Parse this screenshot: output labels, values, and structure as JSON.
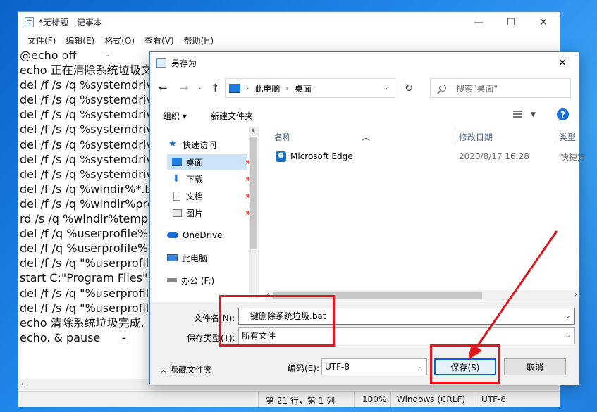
{
  "notepad": {
    "title": "*无标题 - 记事本",
    "menu": [
      "文件(F)",
      "编辑(E)",
      "格式(O)",
      "查看(V)",
      "帮助(H)"
    ],
    "lines": [
      "@echo off        -",
      "echo 正在清除系统垃圾文",
      "del /f /s /q %systemdrive",
      "del /f /s /q %systemdrive",
      "del /f /s /q %systemdrive",
      "del /f /s /q %systemdrive",
      "del /f /s /q %systemdrive",
      "del /f /s /q %systemdrive",
      "del /f /s /q %systemdrive",
      "del /f /s /q %windir%*.ba",
      "del /f /s /q %windir%pre",
      "rd /s /q %windir%temp &",
      "del /f /q %userprofile%c",
      "del /f /q %userprofile%re",
      "del /f /s /q \"%userprofile",
      "start C:\"Program Files\"\"I",
      "del /f /s /q \"%userprofile",
      "del /f /s /q \"%userprofile",
      "echo 清除系统垃圾完成,",
      "echo. & pause      -"
    ],
    "status": {
      "position": "第 21 行，第 1 列",
      "zoom": "100%",
      "line_ending": "Windows (CRLF)",
      "encoding": "UTF-8"
    }
  },
  "dialog": {
    "title": "另存为",
    "address": {
      "root": "此电脑",
      "current": "桌面"
    },
    "search_placeholder": "搜索\"桌面\"",
    "toolbar": {
      "organize": "组织 ▾",
      "new_folder": "新建文件夹"
    },
    "tree": [
      {
        "label": "快速访问",
        "pinned": false
      },
      {
        "label": "桌面",
        "pinned": true
      },
      {
        "label": "下载",
        "pinned": true
      },
      {
        "label": "文档",
        "pinned": true
      },
      {
        "label": "图片",
        "pinned": true
      },
      {
        "label": "OneDrive",
        "pinned": false
      },
      {
        "label": "此电脑",
        "pinned": false
      },
      {
        "label": "办公 (F:)",
        "pinned": false
      }
    ],
    "columns": {
      "name": "名称",
      "date": "修改日期",
      "type": "类型"
    },
    "files": [
      {
        "name": "Microsoft Edge",
        "date": "2020/8/17 16:28",
        "type": "快捷方"
      }
    ],
    "form": {
      "filename_label": "文件名(N):",
      "filename_value": "一键删除系统垃圾.bat",
      "filetype_label": "保存类型(T):",
      "filetype_value": "所有文件",
      "hide_folders": "隐藏文件夹",
      "encoding_label": "编码(E):",
      "encoding_value": "UTF-8",
      "save": "保存(S)",
      "cancel": "取消"
    }
  },
  "colors": {
    "accent": "#0a64c8",
    "annotation": "#e2161a",
    "desktop": "#1e86e8"
  }
}
